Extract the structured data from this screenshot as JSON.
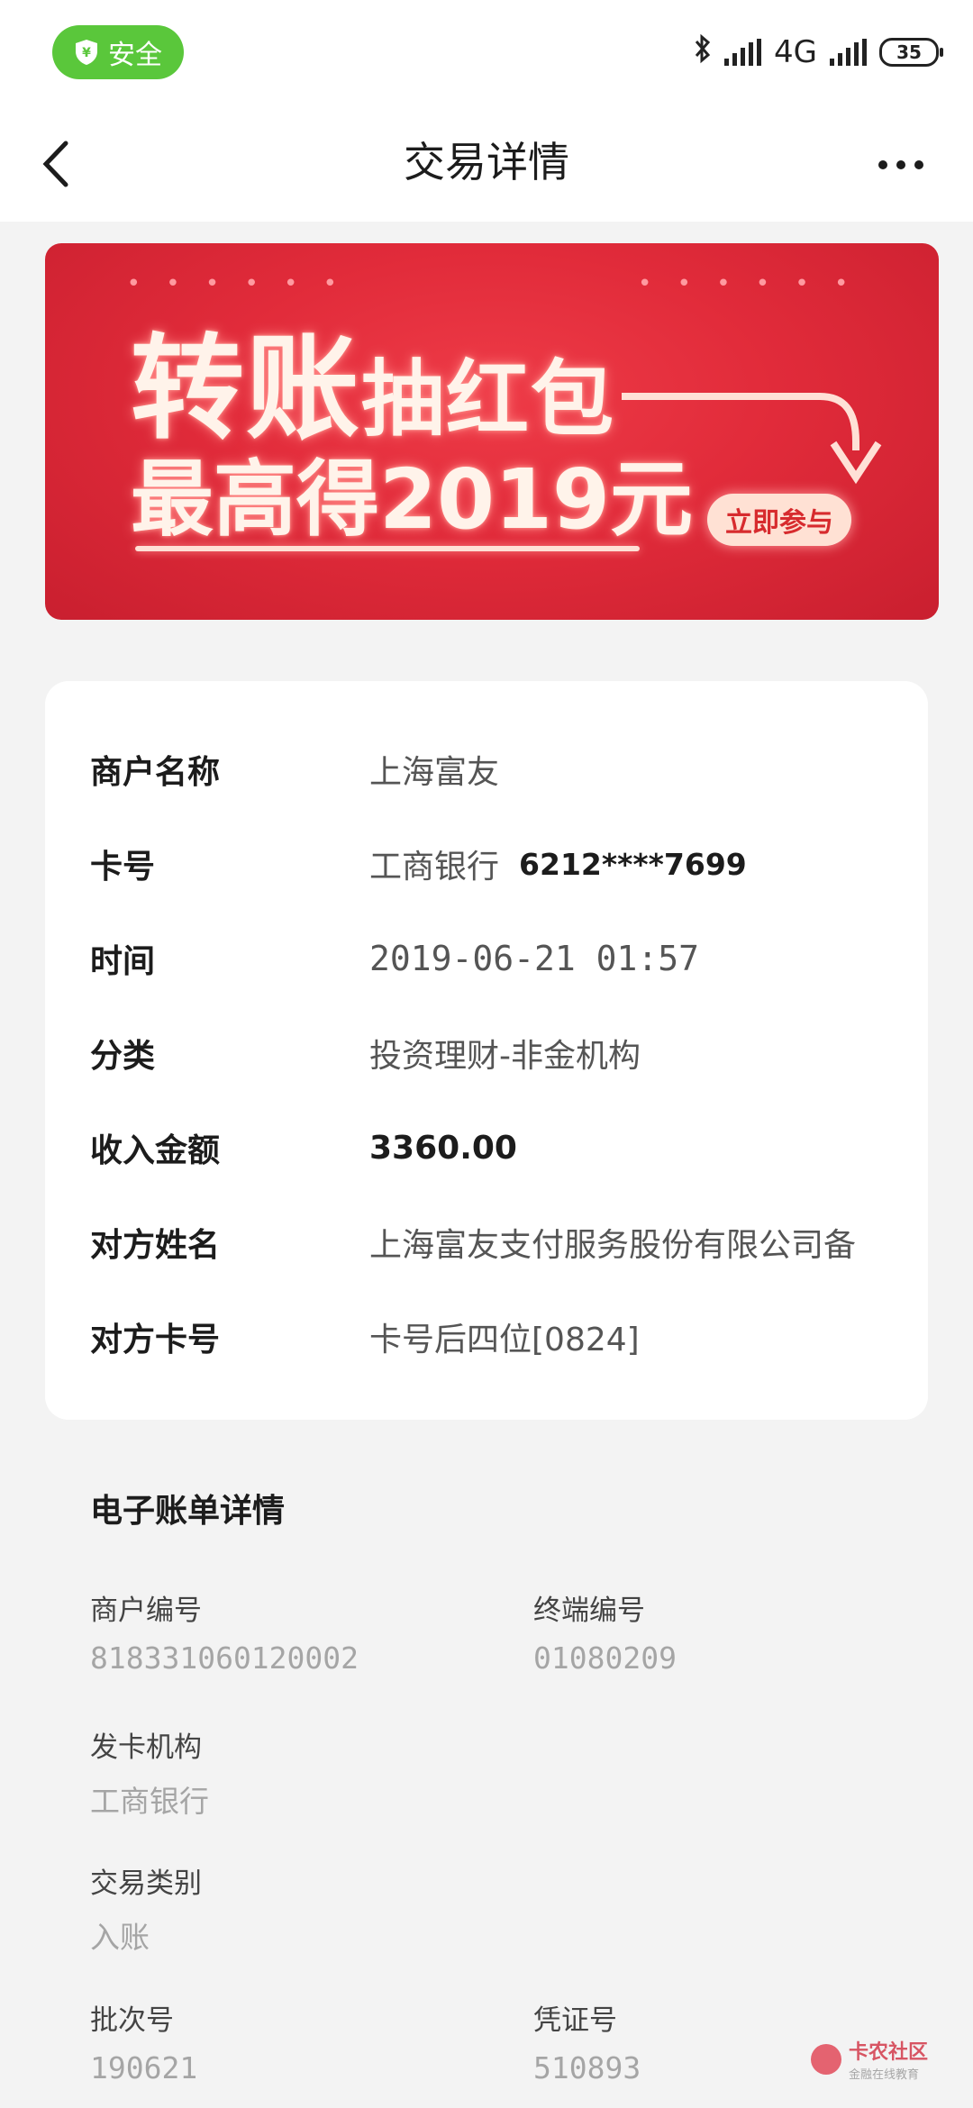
{
  "status_bar": {
    "safe_label": "安全",
    "network": "4G",
    "battery": "35"
  },
  "header": {
    "title": "交易详情"
  },
  "banner": {
    "line1_big": "转账",
    "line1_small": "抽红包",
    "line2": "最高得2019元",
    "cta": "立即参与"
  },
  "detail": {
    "rows": [
      {
        "label": "商户名称",
        "value": "上海富友"
      },
      {
        "label": "卡号",
        "bank": "工商银行",
        "card_no": "6212****7699"
      },
      {
        "label": "时间",
        "value": "2019-06-21 01:57"
      },
      {
        "label": "分类",
        "value": "投资理财-非金机构"
      },
      {
        "label": "收入金额",
        "value": "3360.00"
      },
      {
        "label": "对方姓名",
        "value": "上海富友支付服务股份有限公司备"
      },
      {
        "label": "对方卡号",
        "value": "卡号后四位[0824]"
      }
    ]
  },
  "ebill": {
    "title": "电子账单详情",
    "merchant_no_label": "商户编号",
    "merchant_no": "818331060120002",
    "terminal_no_label": "终端编号",
    "terminal_no": "01080209",
    "issuer_label": "发卡机构",
    "issuer": "工商银行",
    "tx_type_label": "交易类别",
    "tx_type": "入账",
    "batch_no_label": "批次号",
    "batch_no": "190621",
    "voucher_no_label": "凭证号",
    "voucher_no": "510893"
  },
  "watermark": {
    "main": "卡农社区",
    "sub": "金融在线教育"
  }
}
